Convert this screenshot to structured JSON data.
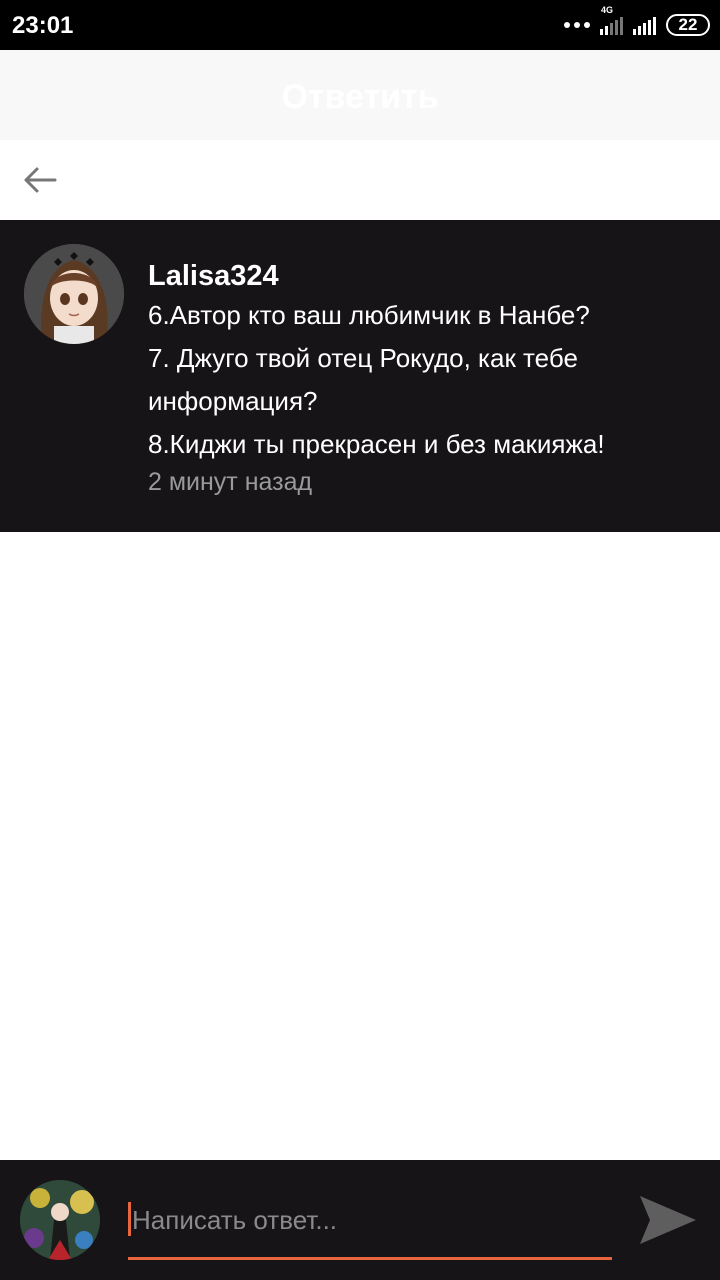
{
  "status_bar": {
    "time": "23:01",
    "network_label": "4G",
    "battery_level": "22",
    "icons": [
      "more-dots-icon",
      "signal-4g-icon",
      "signal-icon",
      "battery-icon"
    ]
  },
  "header": {
    "title": "Ответить"
  },
  "comment": {
    "author": "Lalisa324",
    "lines": [
      "6.Автор кто ваш любимчик в Нанбе?",
      "7. Джуго твой отец Рокудо, как тебе",
      "информация?",
      "8.Киджи ты прекрасен и без макияжа!"
    ],
    "timestamp": "2 минут назад"
  },
  "reply": {
    "placeholder": "Написать ответ...",
    "value": ""
  },
  "colors": {
    "accent": "#e8663d",
    "dark_bg": "#161417",
    "header_bg": "#f8f8f8",
    "muted_text": "#9a9a9a"
  }
}
